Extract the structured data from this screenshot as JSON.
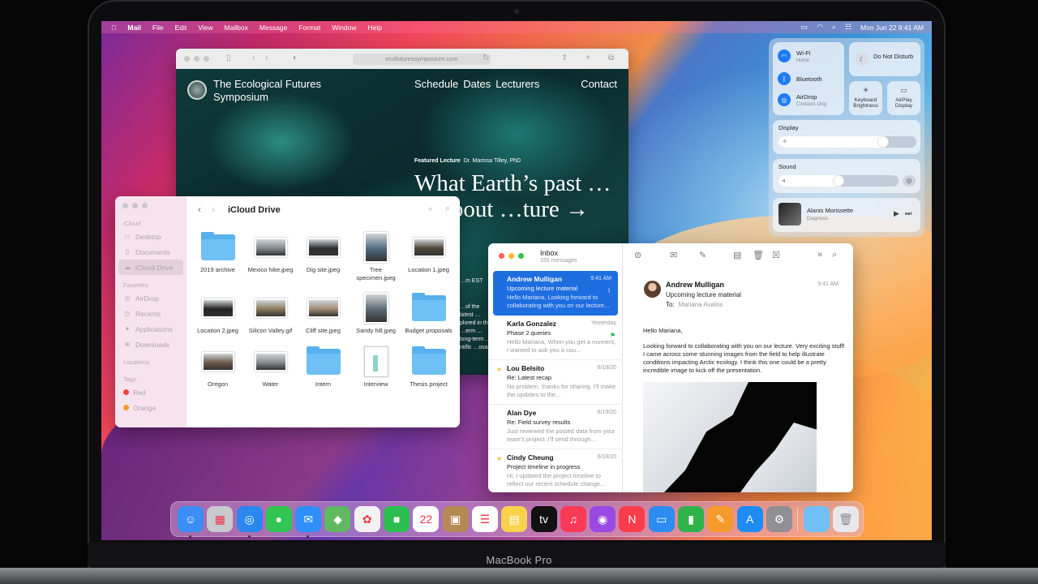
{
  "menubar": {
    "app": "Mail",
    "items": [
      "File",
      "Edit",
      "View",
      "Mailbox",
      "Message",
      "Format",
      "Window",
      "Help"
    ],
    "date_time": "Mon Jun 22  9:41 AM"
  },
  "safari": {
    "url": "ecofuturessymposium.com",
    "site_name": "The Ecological Futures Symposium",
    "nav": [
      "Schedule",
      "Dates",
      "Lecturers"
    ],
    "contact": "Contact",
    "kicker_label": "Featured Lecture",
    "kicker_author": "Dr. Marissa Tilley, PhD",
    "headline": "What Earth’s past … us about …ture →",
    "time_fragment": "…m EST",
    "blurb_fragment": "…of the latest …plored in the …erm … long-term …ntific …osals"
  },
  "finder": {
    "title": "iCloud Drive",
    "sidebar": {
      "section_icloud": "iCloud",
      "icloud_items": [
        "Desktop",
        "Documents",
        "iCloud Drive"
      ],
      "section_favorites": "Favorites",
      "favorite_items": [
        "AirDrop",
        "Recents",
        "Applications",
        "Downloads"
      ],
      "section_locations": "Locations",
      "section_tags": "Tags",
      "tags": [
        {
          "name": "Red",
          "color": "#f0443a"
        },
        {
          "name": "Orange",
          "color": "#f59a2a"
        }
      ]
    },
    "files": [
      {
        "name": "2019 archive",
        "kind": "folder"
      },
      {
        "name": "Mexico hike.jpeg",
        "kind": "photo"
      },
      {
        "name": "Dig site.jpeg",
        "kind": "photo"
      },
      {
        "name": "Tree specimen.jpeg",
        "kind": "photo"
      },
      {
        "name": "Location 1.jpeg",
        "kind": "photo"
      },
      {
        "name": "Location 2.jpeg",
        "kind": "photo"
      },
      {
        "name": "Silicon Valley.gif",
        "kind": "photo"
      },
      {
        "name": "Cliff site.jpeg",
        "kind": "photo"
      },
      {
        "name": "Sandy hill.jpeg",
        "kind": "photo"
      },
      {
        "name": "Budget proposals",
        "kind": "folder"
      },
      {
        "name": "Oregon",
        "kind": "photo"
      },
      {
        "name": "Water",
        "kind": "photo"
      },
      {
        "name": "Intern",
        "kind": "folder"
      },
      {
        "name": "Interview",
        "kind": "doc"
      },
      {
        "name": "Thesis project",
        "kind": "folder"
      }
    ]
  },
  "mail": {
    "mailbox": "Inbox",
    "count": "155 messages",
    "messages": [
      {
        "from": "Andrew Mulligan",
        "date": "9:41 AM",
        "subject": "Upcoming lecture material",
        "preview": "Hello Mariana, Looking forward to collaborating with you on our lecture..."
      },
      {
        "from": "Karla Gonzalez",
        "date": "Yesterday",
        "subject": "Phase 2 queries",
        "preview": "Hello Mariana, When you get a moment, I wanted to ask you a cou..."
      },
      {
        "from": "Lou Belsito",
        "date": "6/19/20",
        "subject": "Re: Latest recap",
        "preview": "No problem, thanks for sharing. I'll make the updates to the..."
      },
      {
        "from": "Alan Dye",
        "date": "6/19/20",
        "subject": "Re: Field survey results",
        "preview": "Just reviewed the posted data from your team's project. I'll send through..."
      },
      {
        "from": "Cindy Cheung",
        "date": "6/18/20",
        "subject": "Project timeline in progress",
        "preview": "Hi, I updated the project timeline to reflect our recent schedule change..."
      }
    ],
    "reader": {
      "sender": "Andrew Mulligan",
      "subject": "Upcoming lecture material",
      "to_label": "To:",
      "to": "Mariana Avalos",
      "time": "9:41 AM",
      "greeting": "Hello Mariana,",
      "body": "Looking forward to collaborating with you on our lecture. Very exciting stuff! I came across some stunning images from the field to help illustrate conditions impacting Arctic ecology. I think this one could be a pretty incredible image to kick off the presentation."
    }
  },
  "control_center": {
    "wifi_label": "Wi-Fi",
    "wifi_sub": "Home",
    "bluetooth_label": "Bluetooth",
    "airdrop_label": "AirDrop",
    "airdrop_sub": "Contacts Only",
    "dnd_label": "Do Not Disturb",
    "kb_label": "Keyboard Brightness",
    "airplay_label": "AirPlay Display",
    "display_label": "Display",
    "display_level": 0.8,
    "sound_label": "Sound",
    "sound_level": 0.55,
    "now_playing_artist": "Alanis Morissette",
    "now_playing_track": "Diagnosis"
  },
  "dock": {
    "apps": [
      {
        "name": "finder-app",
        "color": "#3a8ef5",
        "glyph": "☺",
        "running": true
      },
      {
        "name": "launchpad-app",
        "color": "#c9c9d1",
        "glyph": "▦",
        "running": false
      },
      {
        "name": "safari-app",
        "color": "#2a86f0",
        "glyph": "◎",
        "running": true
      },
      {
        "name": "messages-app",
        "color": "#30c651",
        "glyph": "●",
        "running": false
      },
      {
        "name": "mail-app",
        "color": "#2f8ef7",
        "glyph": "✉",
        "running": true
      },
      {
        "name": "maps-app",
        "color": "#60b860",
        "glyph": "◆",
        "running": false
      },
      {
        "name": "photos-app",
        "color": "#f2f2f2",
        "glyph": "✿",
        "running": false
      },
      {
        "name": "facetime-app",
        "color": "#2cbe4e",
        "glyph": "■",
        "running": false
      },
      {
        "name": "calendar-app",
        "color": "#ffffff",
        "glyph": "22",
        "running": false
      },
      {
        "name": "contacts-app",
        "color": "#b58a55",
        "glyph": "▣",
        "running": false
      },
      {
        "name": "reminders-app",
        "color": "#ffffff",
        "glyph": "☰",
        "running": false
      },
      {
        "name": "notes-app",
        "color": "#f7d24a",
        "glyph": "▤",
        "running": false
      },
      {
        "name": "tv-app",
        "color": "#111111",
        "glyph": "tv",
        "running": false
      },
      {
        "name": "music-app",
        "color": "#fb3a58",
        "glyph": "♫",
        "running": false
      },
      {
        "name": "podcasts-app",
        "color": "#9a4ae2",
        "glyph": "◉",
        "running": false
      },
      {
        "name": "news-app",
        "color": "#fb3c4b",
        "glyph": "N",
        "running": false
      },
      {
        "name": "keynote-app",
        "color": "#2d8cf0",
        "glyph": "▭",
        "running": false
      },
      {
        "name": "numbers-app",
        "color": "#2fb34a",
        "glyph": "▮",
        "running": false
      },
      {
        "name": "pages-app",
        "color": "#f69a2b",
        "glyph": "✎",
        "running": false
      },
      {
        "name": "app-store-app",
        "color": "#1d8cf7",
        "glyph": "A",
        "running": false
      },
      {
        "name": "system-preferences-app",
        "color": "#8f8f95",
        "glyph": "⚙",
        "running": false
      }
    ],
    "folder_color": "#6ec0f5",
    "trash_color": "#e8e8ec"
  },
  "device": {
    "brand": "MacBook Pro"
  }
}
